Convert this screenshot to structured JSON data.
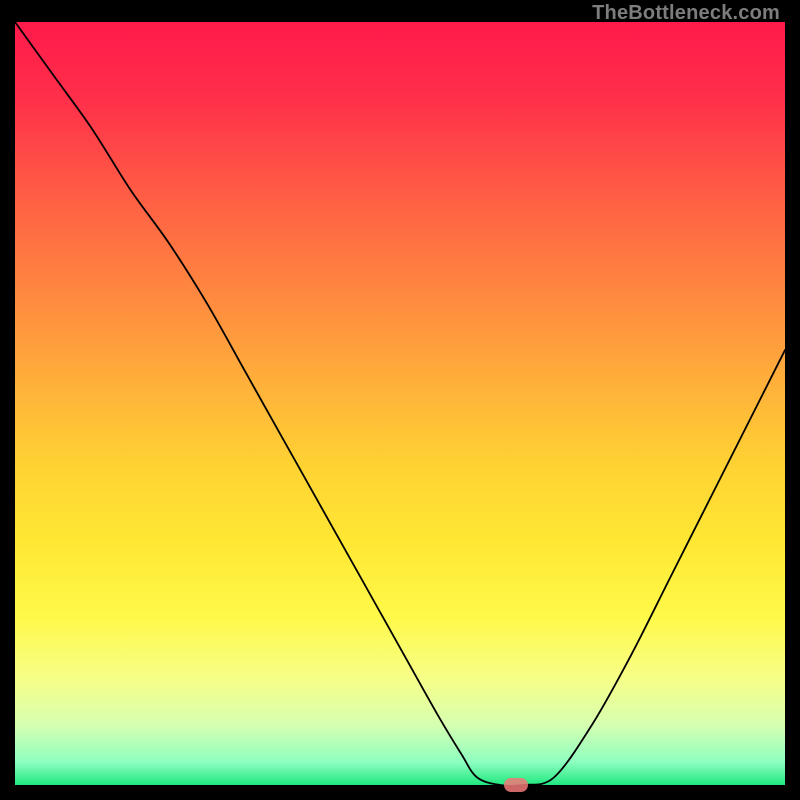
{
  "watermark": "TheBottleneck.com",
  "chart_data": {
    "type": "line",
    "title": "",
    "xlabel": "",
    "ylabel": "",
    "xlim": [
      0,
      100
    ],
    "ylim": [
      0,
      100
    ],
    "series": [
      {
        "name": "bottleneck-curve",
        "x": [
          0,
          5,
          10,
          15,
          20,
          25,
          30,
          35,
          40,
          45,
          50,
          55,
          58,
          60,
          63,
          66,
          70,
          75,
          80,
          85,
          90,
          95,
          100
        ],
        "y": [
          100,
          93,
          86,
          78,
          71,
          63,
          54,
          45,
          36,
          27,
          18,
          9,
          4,
          1,
          0,
          0,
          1,
          8,
          17,
          27,
          37,
          47,
          57
        ]
      }
    ],
    "marker": {
      "x": 65,
      "y": 0
    },
    "gradient_stops": [
      {
        "pos": 0,
        "color": "#ff1a4b"
      },
      {
        "pos": 10,
        "color": "#ff2f4a"
      },
      {
        "pos": 22,
        "color": "#ff5b45"
      },
      {
        "pos": 35,
        "color": "#ff8640"
      },
      {
        "pos": 48,
        "color": "#ffb23a"
      },
      {
        "pos": 58,
        "color": "#ffd233"
      },
      {
        "pos": 68,
        "color": "#ffe733"
      },
      {
        "pos": 78,
        "color": "#fff94a"
      },
      {
        "pos": 86,
        "color": "#f6ff87"
      },
      {
        "pos": 92,
        "color": "#d7ffb0"
      },
      {
        "pos": 97,
        "color": "#8dffc0"
      },
      {
        "pos": 100,
        "color": "#20e87f"
      }
    ]
  }
}
